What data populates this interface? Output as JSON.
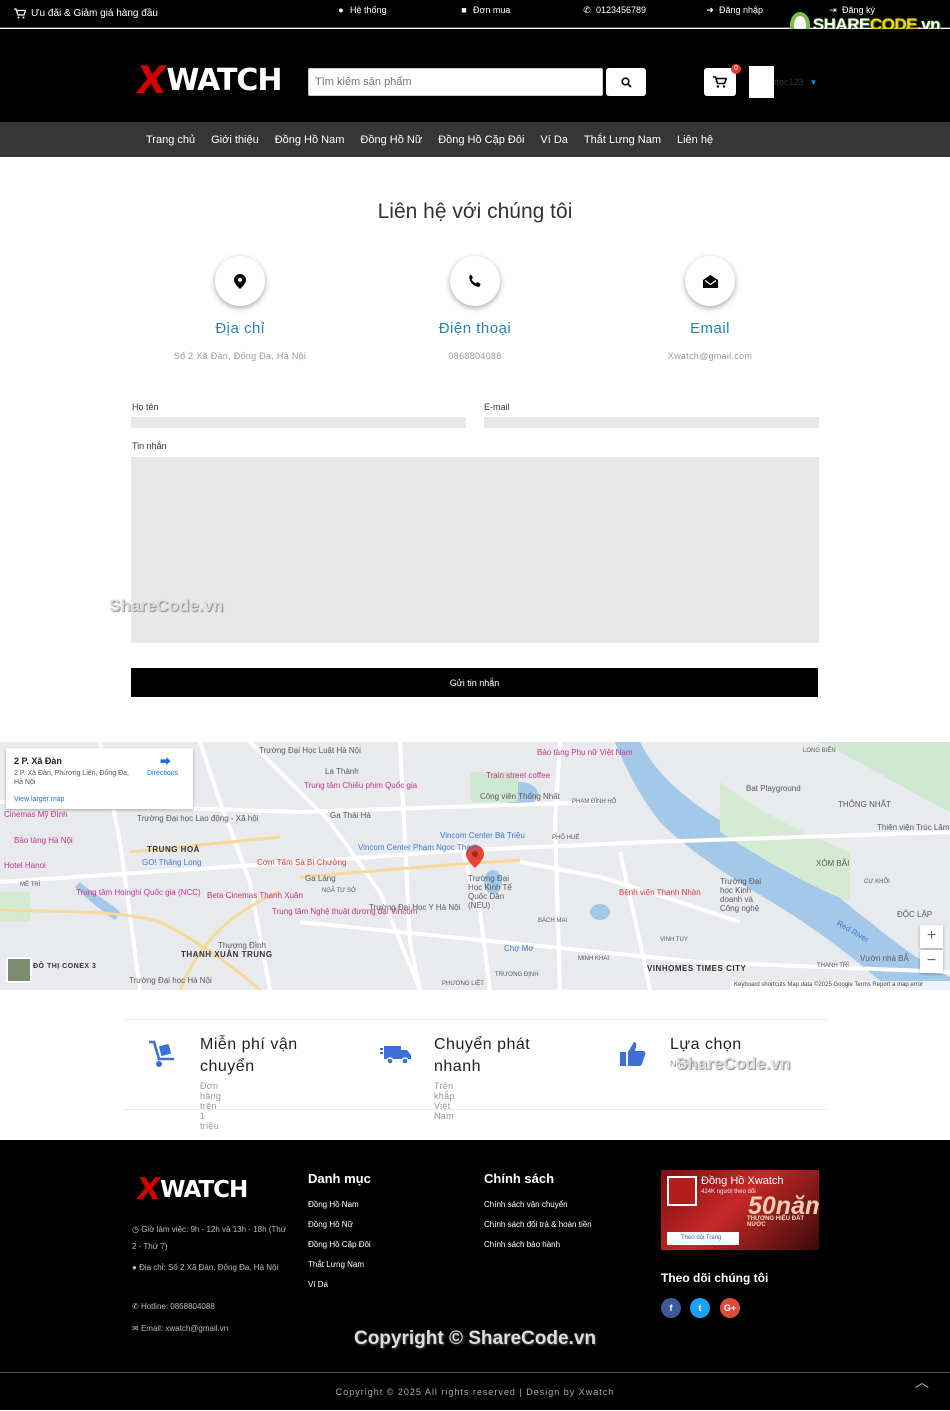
{
  "topbar": {
    "promo": "Ưu đãi & Giảm giá hàng đầu",
    "links": [
      "Hệ thống",
      "Đơn mua",
      "0123456789",
      "Đăng nhập",
      "Đăng ký"
    ],
    "watermark": {
      "share": "SHARE",
      "code": "CODE",
      "vn": ".vn"
    }
  },
  "header": {
    "logo_x": "X",
    "logo_text": "WATCH",
    "search_placeholder": "Tìm kiếm sản phẩm",
    "cart_count": "0",
    "username": "ttoc123"
  },
  "nav": [
    "Trang chủ",
    "Giới thiệu",
    "Đồng Hồ Nam",
    "Đồng Hồ Nữ",
    "Đồng Hồ Cặp Đôi",
    "Ví Da",
    "Thắt Lưng Nam",
    "Liên hệ"
  ],
  "contact": {
    "title": "Liên hệ với chúng tôi",
    "cards": [
      {
        "title": "Địa chỉ",
        "text": "Số 2 Xã Đàn, Đống Đa, Hà Nội",
        "icon": "map-marker-icon"
      },
      {
        "title": "Điện thoại",
        "text": "0868804088",
        "icon": "phone-icon"
      },
      {
        "title": "Email",
        "text": "Xwatch@gmail.com",
        "icon": "envelope-icon"
      }
    ],
    "form": {
      "name_label": "Họ tên",
      "email_label": "E-mail",
      "message_label": "Tin nhắn",
      "submit": "Gửi tin nhắn"
    },
    "watermark": "ShareCode.vn"
  },
  "map": {
    "card_title": "2 P. Xã Đàn",
    "card_address": "2 P. Xã Đàn, Phương Liên, Đống Đa, Hà Nội",
    "directions": "Directions",
    "larger_map": "View larger map",
    "zoom_in": "+",
    "zoom_out": "−",
    "attribution": "Keyboard shortcuts   Map data ©2025 Google   Terms   Report a map error",
    "labels": {
      "l1": "Trường Đại Học Luật Hà Nội",
      "l2": "La Thành",
      "l3": "Trung tâm Chiếu phim Quốc gia",
      "l4": "Bảo tàng Phụ nữ Việt Nam",
      "l5": "Train street coffee",
      "l6": "Công viên Thống Nhất",
      "l7": "PHẠM ĐÌNH HỔ",
      "l8": "LONG BIÊN",
      "l9": "Bat Playground",
      "l10": "THÔNG NHẤT",
      "l11": "Thiên viện Trúc Lâm Sùng Phúc",
      "l12": "Cinemas Mỹ Đình",
      "l13": "Trường Đại học Lao động - Xã hội",
      "l14": "Ga Thái Hà",
      "l15": "Vincom Center Bà Triệu",
      "l16": "PHỐ HUẾ",
      "l17": "Bảo tàng Hà Nội",
      "l18": "TRUNG HOÀ",
      "l19": "GO! Thăng Long",
      "l20": "Cơm Tấm Sà Bì Chưởng",
      "l21": "Vincom Center Phạm Ngọc Thạch",
      "l22": "XÓM BÃI",
      "l23": "Hotel Hanoi",
      "l24": "Ga Láng",
      "l25": "Trường Đại Học Kinh Tế Quốc Dân (NEU)",
      "l26": "Bệnh viện Thanh Nhàn",
      "l27": "CỰ KHỐI",
      "l28": "MỄ TRÌ",
      "l29": "Trung tâm Hoinghi Quốc gia (NCC)",
      "l30": "Beta Cinemas Thanh Xuân",
      "l31": "NGÃ TƯ SỞ",
      "l32": "Trường Đại học Kinh doanh và Công nghệ",
      "l33": "ĐỘC LẬP",
      "l34": "Trung tâm Nghệ thuật đương đại Vincom",
      "l35": "Trường Đại Học Y Hà Nội",
      "l36": "BÁCH MAI",
      "l37": "Thượng Đình",
      "l38": "THANH XUÂN TRUNG",
      "l39": "Chợ Mơ",
      "l40": "VINH TUY",
      "l41": "VINHOMES TIMES CITY",
      "l42": "THANH TRÌ",
      "l43": "Vườn nhà BÃ",
      "l44": "ĐÔ THỊ CONEX 3",
      "l45": "Trường Đại học Hà Nội",
      "l46": "TRƯƠNG ĐỊNH",
      "l47": "PHƯƠNG LIỆT",
      "l48": "MINH KHAI",
      "l49": "Red River"
    }
  },
  "features": [
    {
      "title": "Miễn phí vận chuyển",
      "sub": "Đơn hàng trên 1 triệu",
      "icon": "hand-truck-icon"
    },
    {
      "title": "Chuyển phát nhanh",
      "sub": "Trên khắp Việt Nam",
      "icon": "delivery-truck-icon"
    },
    {
      "title": "Lựa chọn",
      "sub": "Nhiều",
      "icon": "thumbs-up-icon"
    }
  ],
  "features_watermark": "ShareCode.vn",
  "footer": {
    "info": [
      "Giờ làm việc: 9h - 12h và 13h - 18h (Thứ 2 - Thứ 7)",
      "Địa chỉ: Số 2 Xã Đàn, Đống Đa, Hà Nội",
      "Hotline: 0868804088",
      "Email: xwatch@gmail.vn"
    ],
    "categories_title": "Danh mục",
    "categories": [
      "Đồng Hồ Nam",
      "Đồng Hồ Nữ",
      "Đồng Hồ Cặp Đôi",
      "Thắt Lưng Nam",
      "Ví Da"
    ],
    "policies_title": "Chính sách",
    "policies": [
      "Chính sách vận chuyển",
      "Chính sách đổi trả & hoàn tiền",
      "Chính sách bảo hành"
    ],
    "fb": {
      "page_name": "Đồng Hồ Xwatch",
      "followers": "424K người theo dõi",
      "years": "50năm",
      "slogan": "THƯƠNG HIỆU ĐẤT NƯỚC",
      "follow_btn": "Theo dõi Trang"
    },
    "follow_title": "Theo dõi chúng tôi",
    "social": [
      "f",
      "t",
      "G+"
    ],
    "copyright_watermark": "Copyright © ShareCode.vn",
    "bottom": "Copyright © 2025 All rights reserved | Design by Xwatch",
    "totop": "︿"
  },
  "colors": {
    "accent_blue": "#2980b9",
    "dark": "#000000",
    "nav": "#363636",
    "facebook": "#3b5998",
    "twitter": "#1da1f2",
    "google": "#dd4b39"
  }
}
